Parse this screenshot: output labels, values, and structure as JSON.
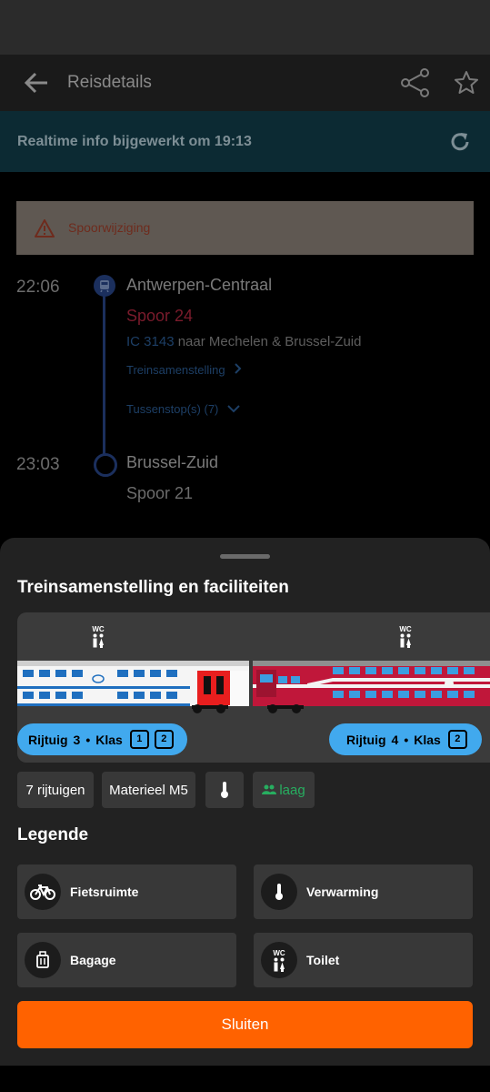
{
  "header": {
    "title": "Reisdetails"
  },
  "realtime": {
    "text": "Realtime info bijgewerkt om 19:13"
  },
  "alert": {
    "text": "Spoorwijziging"
  },
  "journey": {
    "departure": {
      "time": "22:06",
      "station": "Antwerpen-Centraal",
      "track": "Spoor 24"
    },
    "train": {
      "id": "IC 3143",
      "destination": "naar Mechelen & Brussel-Zuid"
    },
    "composition_link": "Treinsamenstelling",
    "stops_link": "Tussenstop(s) (7)",
    "arrival": {
      "time": "23:03",
      "station": "Brussel-Zuid",
      "track": "Spoor 21"
    }
  },
  "sheet": {
    "title": "Treinsamenstelling en faciliteiten",
    "wc_label": "WC",
    "cars": [
      {
        "label": "Rijtuig",
        "number": "3",
        "klas_label": "Klas",
        "classes": [
          "1",
          "2"
        ]
      },
      {
        "label": "Rijtuig",
        "number": "4",
        "klas_label": "Klas",
        "classes": [
          "2"
        ]
      }
    ],
    "chips": {
      "cars": "7 rijtuigen",
      "material": "Materieel M5",
      "occupancy": "laag"
    },
    "legend_title": "Legende",
    "legend": [
      {
        "label": "Fietsruimte",
        "icon": "bike-icon"
      },
      {
        "label": "Verwarming",
        "icon": "thermometer-icon"
      },
      {
        "label": "Bagage",
        "icon": "luggage-icon"
      },
      {
        "label": "Toilet",
        "icon": "wc-icon"
      }
    ],
    "close_label": "Sluiten"
  },
  "colors": {
    "accent": "#ff6200",
    "badge": "#41a9ee",
    "occupancy": "#27ae60"
  }
}
